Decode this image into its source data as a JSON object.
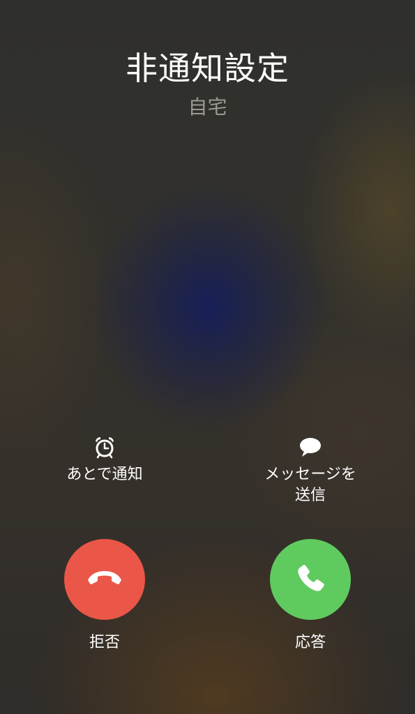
{
  "caller": {
    "name": "非通知設定",
    "label": "自宅"
  },
  "options": {
    "remind": {
      "label": "あとで通知",
      "icon": "alarm-clock-icon"
    },
    "message": {
      "label": "メッセージを\n送信",
      "icon": "message-bubble-icon"
    }
  },
  "actions": {
    "decline": {
      "label": "拒否",
      "color": "#ea5647",
      "icon": "phone-hangup-icon"
    },
    "accept": {
      "label": "応答",
      "color": "#5fcb5f",
      "icon": "phone-icon"
    }
  }
}
